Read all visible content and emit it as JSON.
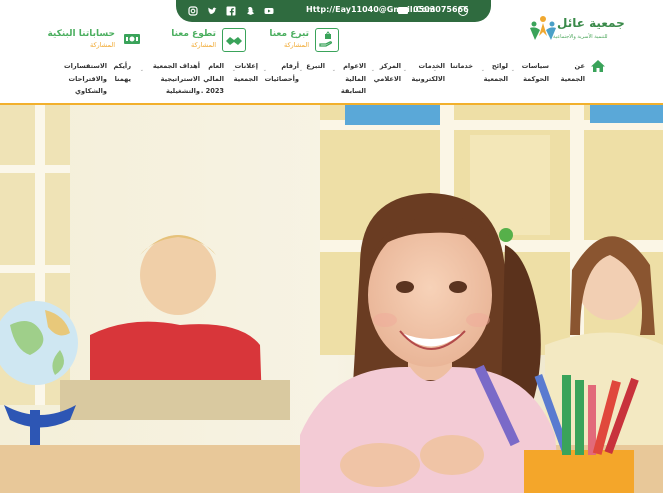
{
  "topbar": {
    "socials": [
      "instagram-icon",
      "twitter-icon",
      "facebook-icon",
      "snapchat-icon",
      "youtube-icon"
    ],
    "email": "Http://Eay11040@Gmail.Com",
    "phone": "0503075666"
  },
  "logo": {
    "name": "جمعية عائل",
    "subtitle": "للتنمية الأسرية والاجتماعية"
  },
  "actions": [
    {
      "title": "تبرع معنا",
      "subtitle": "المشاركة"
    },
    {
      "title": "تطوع معنا",
      "subtitle": "المشاركة"
    },
    {
      "title": "حساباتنا البنكية",
      "subtitle": "المشاركة"
    }
  ],
  "nav": [
    {
      "label": "عن\nالجمعية"
    },
    {
      "label": "سياسات\nالحوكمة"
    },
    {
      "label": "لوائح\nالجمعية"
    },
    {
      "label": "خدماتنا"
    },
    {
      "label": "الخدمات\nالالكترونية"
    },
    {
      "label": "المركز\nالاعلامي"
    },
    {
      "label": "الاعوام\nالمالية\nالسابقة"
    },
    {
      "label": "التبرع"
    },
    {
      "label": "أرقام\nوأحصائيات"
    },
    {
      "label": "إعلانات\nالجمعية"
    },
    {
      "label": "العام\nالمالي\n2023 ."
    },
    {
      "label": "أهداف الجمعية\nالاستراتيجية\nوالتشغيلية"
    },
    {
      "label": "رأيكم\nيهمنا"
    },
    {
      "label": "الاستفسارات\nوالاقتراحات\nوالشكاوي"
    }
  ],
  "colors": {
    "brand_green": "#2f6b3f",
    "accent_green": "#3aa35a",
    "accent_orange": "#f2b02c"
  }
}
